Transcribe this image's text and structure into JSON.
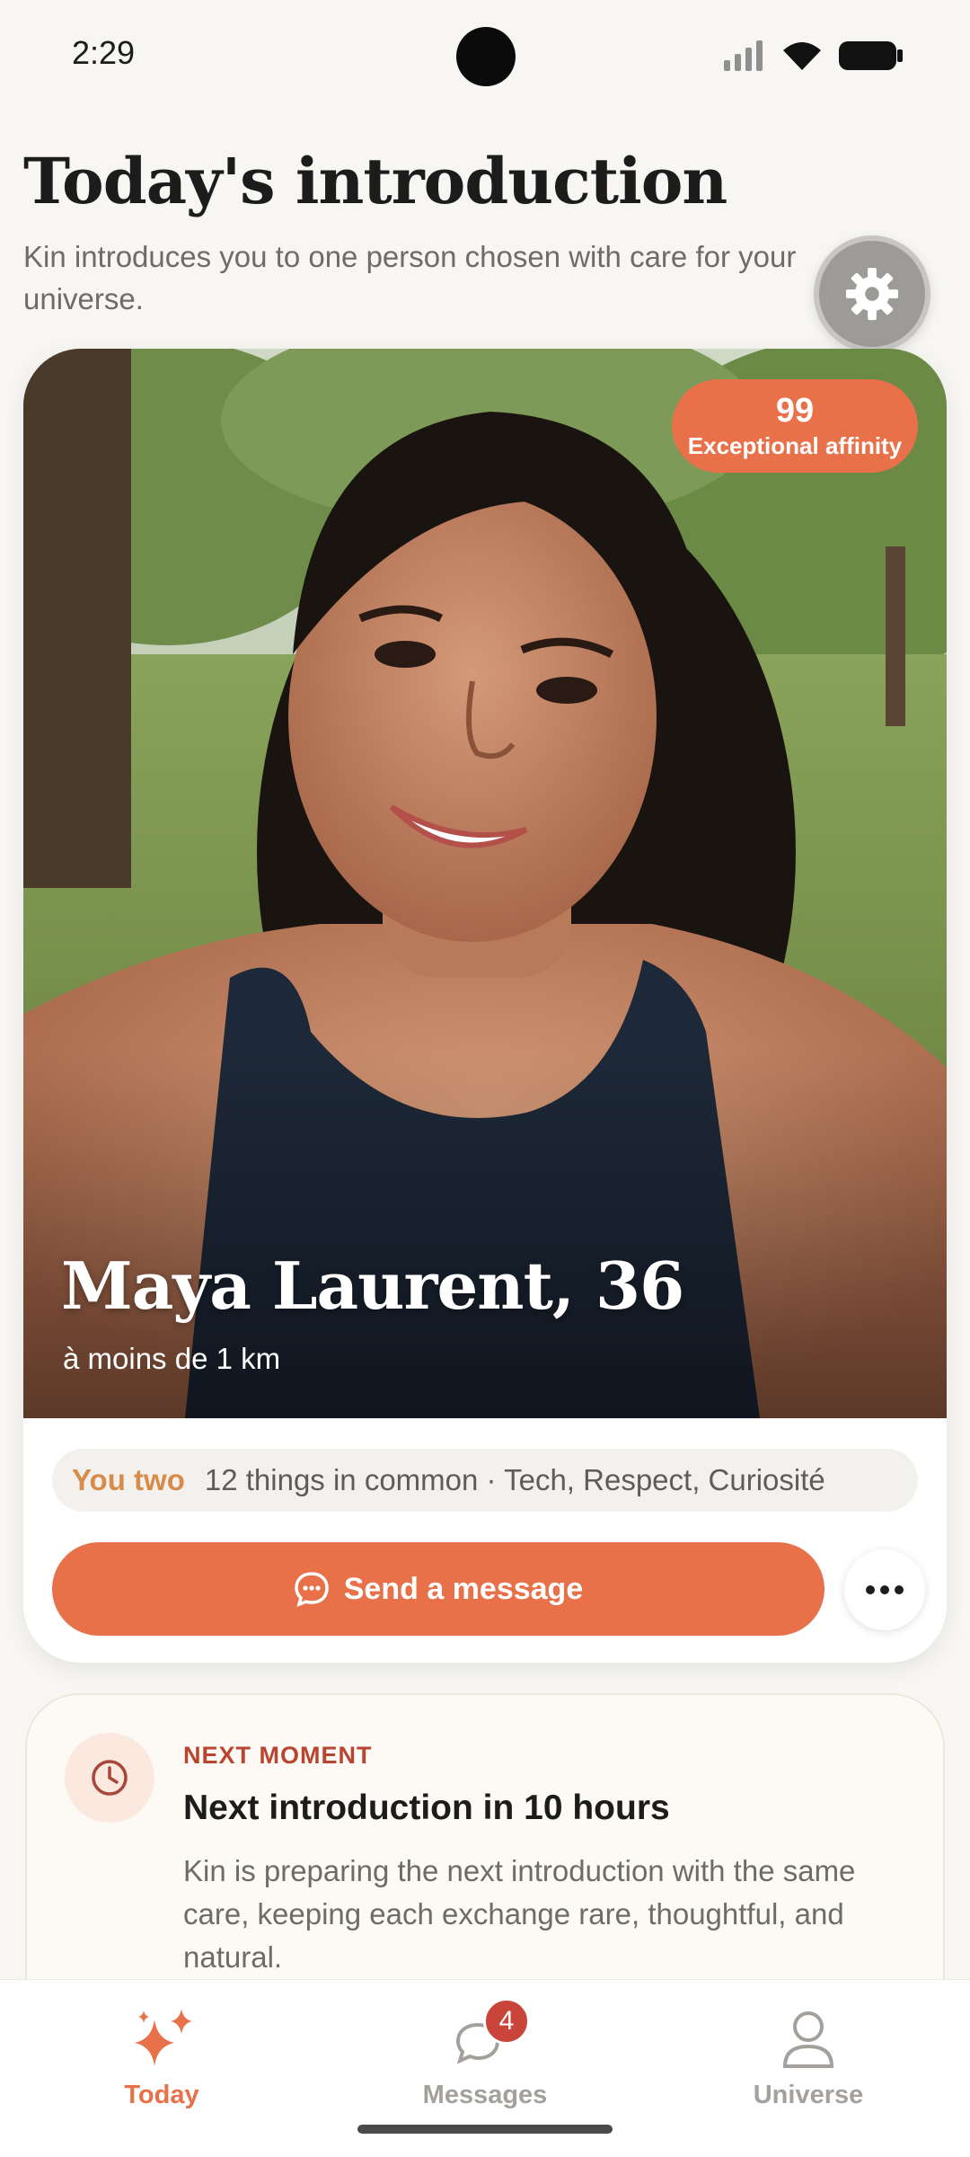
{
  "status_bar": {
    "time": "2:29",
    "icons": [
      "signal-icon",
      "wifi-icon",
      "battery-icon"
    ]
  },
  "header": {
    "title": "Today's introduction",
    "subtitle": "Kin introduces you to one person chosen with care for your universe.",
    "settings_icon": "gear-icon"
  },
  "profile": {
    "name": "Maya Laurent, 36",
    "distance": "à moins de 1 km",
    "affinity_score": "99",
    "affinity_label": "Exceptional affinity",
    "common_label": "You two",
    "common_text": "12 things in common · Tech, Respect, Curiosité",
    "send_label": "Send a message",
    "more_icon": "more-dots-icon"
  },
  "next_moment": {
    "eyebrow": "NEXT MOMENT",
    "title": "Next introduction in 10 hours",
    "body": "Kin is preparing the next introduction with the same care, keeping each exchange rare, thoughtful, and natural.",
    "icon": "clock-icon"
  },
  "nav": {
    "items": [
      {
        "label": "Today",
        "icon": "sparkle-icon",
        "active": true
      },
      {
        "label": "Messages",
        "icon": "chat-bubbles-icon",
        "badge": "4"
      },
      {
        "label": "Universe",
        "icon": "person-icon"
      }
    ]
  },
  "colors": {
    "accent": "#e8714a",
    "badge": "#c9453a",
    "eyebrow": "#b8452f",
    "common_label": "#d98c4a"
  }
}
